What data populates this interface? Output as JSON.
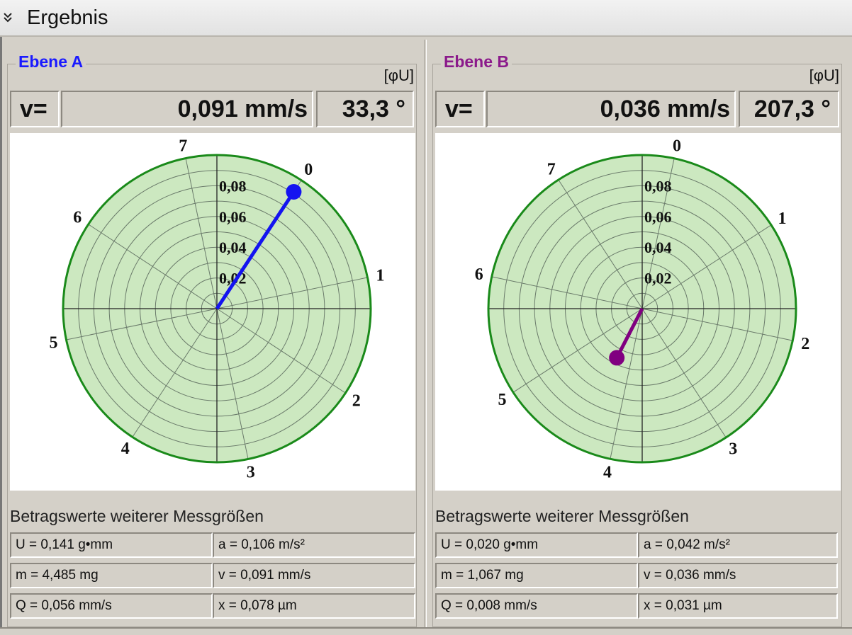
{
  "header": {
    "title": "Ergebnis",
    "toggle_icon": "double-chevron-down-icon"
  },
  "planes": [
    {
      "id": "a",
      "title": "Ebene A",
      "title_color": "#1a1aff",
      "unit_tag": "[φU]",
      "v_label": "v=",
      "v_value": "0,091 mm/s",
      "angle": "33,3 °",
      "measurements_title": "Betragswerte weiterer Messgrößen",
      "measurements": [
        [
          "U = 0,141 g•mm",
          "a = 0,106 m/s²"
        ],
        [
          "m = 4,485 mg",
          "v = 0,091 mm/s"
        ],
        [
          "Q = 0,056 mm/s",
          "x = 0,078 µm"
        ]
      ],
      "chart_data": {
        "type": "polar",
        "ring_labels": [
          "0,02",
          "0,04",
          "0,06",
          "0,08"
        ],
        "ring_values": [
          0.01,
          0.02,
          0.03,
          0.04,
          0.05,
          0.06,
          0.07,
          0.08,
          0.09,
          0.1
        ],
        "rmax": 0.1,
        "sector_labels": [
          "0",
          "1",
          "2",
          "3",
          "4",
          "5",
          "6",
          "7"
        ],
        "sector_offset_deg": 33.3,
        "vector": {
          "magnitude": 0.091,
          "angle_deg": 33.3
        },
        "vector_color": "#1414f0",
        "fill_color": "#cce8c0",
        "border_color": "#1a8a1a"
      }
    },
    {
      "id": "b",
      "title": "Ebene B",
      "title_color": "#8b1a8b",
      "unit_tag": "[φU]",
      "v_label": "v=",
      "v_value": "0,036 mm/s",
      "angle": "207,3 °",
      "measurements_title": "Betragswerte weiterer Messgrößen",
      "measurements": [
        [
          "U = 0,020 g•mm",
          "a = 0,042 m/s²"
        ],
        [
          "m = 1,067 mg",
          "v = 0,036 mm/s"
        ],
        [
          "Q = 0,008 mm/s",
          "x = 0,031 µm"
        ]
      ],
      "chart_data": {
        "type": "polar",
        "ring_labels": [
          "0,02",
          "0,04",
          "0,06",
          "0,08"
        ],
        "ring_values": [
          0.01,
          0.02,
          0.03,
          0.04,
          0.05,
          0.06,
          0.07,
          0.08,
          0.09,
          0.1
        ],
        "rmax": 0.1,
        "sector_labels": [
          "0",
          "1",
          "2",
          "3",
          "4",
          "5",
          "6",
          "7"
        ],
        "sector_offset_deg": 12,
        "vector": {
          "magnitude": 0.036,
          "angle_deg": 207.3
        },
        "vector_color": "#800080",
        "fill_color": "#cce8c0",
        "border_color": "#1a8a1a"
      }
    }
  ]
}
